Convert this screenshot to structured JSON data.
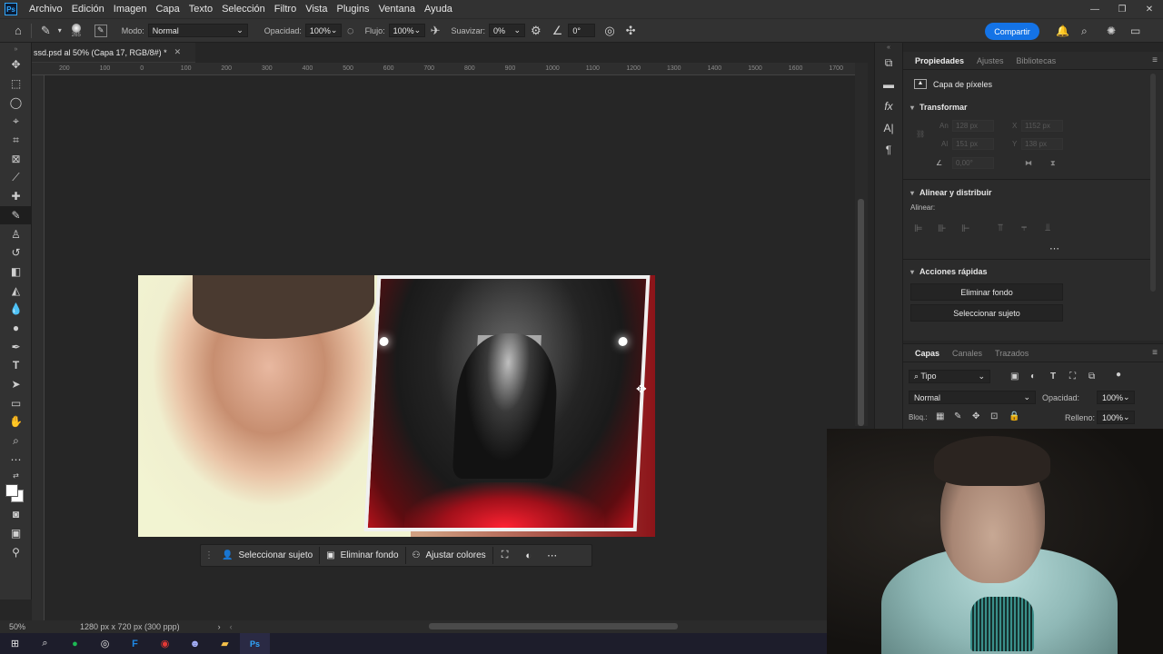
{
  "menubar": {
    "logo": "Ps",
    "items": [
      "Archivo",
      "Edición",
      "Imagen",
      "Capa",
      "Texto",
      "Selección",
      "Filtro",
      "Vista",
      "Plugins",
      "Ventana",
      "Ayuda"
    ]
  },
  "options": {
    "brush_size": "265",
    "mode_label": "Modo:",
    "mode_value": "Normal",
    "opacity_label": "Opacidad:",
    "opacity_value": "100%",
    "flow_label": "Flujo:",
    "flow_value": "100%",
    "smooth_label": "Suavizar:",
    "smooth_value": "0%",
    "angle_value": "0°",
    "share_label": "Compartir"
  },
  "document": {
    "tab_title": "ssd.psd al 50% (Capa 17, RGB/8#) *",
    "ruler_ticks": [
      "200",
      "100",
      "0",
      "100",
      "200",
      "300",
      "400",
      "500",
      "600",
      "700",
      "800",
      "900",
      "1000",
      "1100",
      "1200",
      "1300",
      "1400",
      "1500",
      "1600",
      "1700"
    ],
    "zoom": "50%",
    "doc_info": "1280 px x 720 px (300 ppp)"
  },
  "context_bar": {
    "select_subject": "Seleccionar sujeto",
    "remove_bg": "Eliminar fondo",
    "adjust_colors": "Ajustar colores"
  },
  "properties": {
    "tabs": [
      "Propiedades",
      "Ajustes",
      "Bibliotecas"
    ],
    "layer_kind": "Capa de píxeles",
    "transform_title": "Transformar",
    "an_label": "An",
    "an_value": "128 px",
    "x_label": "X",
    "x_value": "1152 px",
    "al_label": "Al",
    "al_value": "151 px",
    "y_label": "Y",
    "y_value": "138 px",
    "angle_value": "0,00°",
    "align_title": "Alinear y distribuir",
    "align_label": "Alinear:",
    "quick_title": "Acciones rápidas",
    "quick_remove_bg": "Eliminar fondo",
    "quick_select_subject": "Seleccionar sujeto"
  },
  "layers": {
    "tabs": [
      "Capas",
      "Canales",
      "Trazados"
    ],
    "filter_value": "Tipo",
    "blend_value": "Normal",
    "opacity_label": "Opacidad:",
    "opacity_value": "100%",
    "lock_label": "Bloq.:",
    "fill_label": "Relleno:",
    "fill_value": "100%"
  },
  "colors": {
    "accent": "#1473e6",
    "panel": "#2b2b2b",
    "app_bg": "#262626"
  }
}
